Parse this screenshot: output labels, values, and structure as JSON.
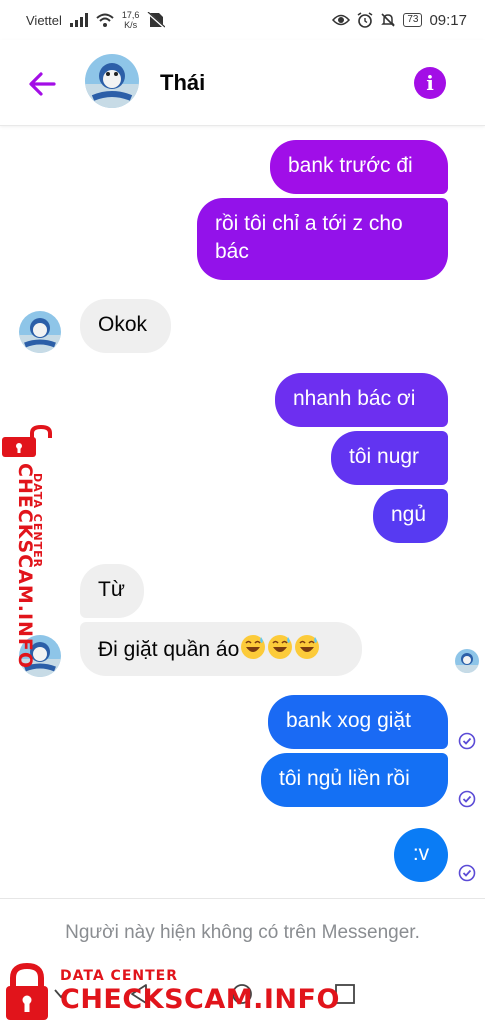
{
  "status_bar": {
    "carrier": "Viettel",
    "speed_value": "17,6",
    "speed_unit": "K/s",
    "battery": "73",
    "time": "09:17",
    "icons": [
      "signal-icon",
      "wifi-icon",
      "no-sim-icon",
      "eye-icon",
      "alarm-icon",
      "mute-icon",
      "battery-icon"
    ]
  },
  "header": {
    "contact_name": "Thái",
    "accent_color": "#a30ee6"
  },
  "messages": [
    {
      "direction": "out",
      "text": "bank trước đi",
      "color": "#a00ee8"
    },
    {
      "direction": "out",
      "text_lines": [
        "rồi tôi chỉ a tới z cho",
        "bác"
      ],
      "color": "#9312ea"
    },
    {
      "direction": "in",
      "text": "Okok"
    },
    {
      "direction": "out",
      "text": "nhanh bác ơi",
      "color": "#6d2ff0"
    },
    {
      "direction": "out",
      "text": "tôi nugr",
      "color": "#6234f1"
    },
    {
      "direction": "out",
      "text": "ngủ",
      "color": "#573af2"
    },
    {
      "direction": "in",
      "text": "Từ"
    },
    {
      "direction": "in",
      "text": "Đi giặt quần áo"
    },
    {
      "direction": "out",
      "text": "bank xog giặt",
      "color": "#1a6af4"
    },
    {
      "direction": "out",
      "text": "tôi ngủ liền rồi",
      "color": "#1470f4"
    },
    {
      "direction": "out",
      "text": ":v",
      "color": "#0a7cf5"
    }
  ],
  "footer": {
    "unavailable_text": "Người này hiện không có trên Messenger."
  },
  "watermark": {
    "small_text": "DATA CENTER",
    "big_text": "CHECKSCAM.INFO",
    "color": "#e1141b"
  }
}
